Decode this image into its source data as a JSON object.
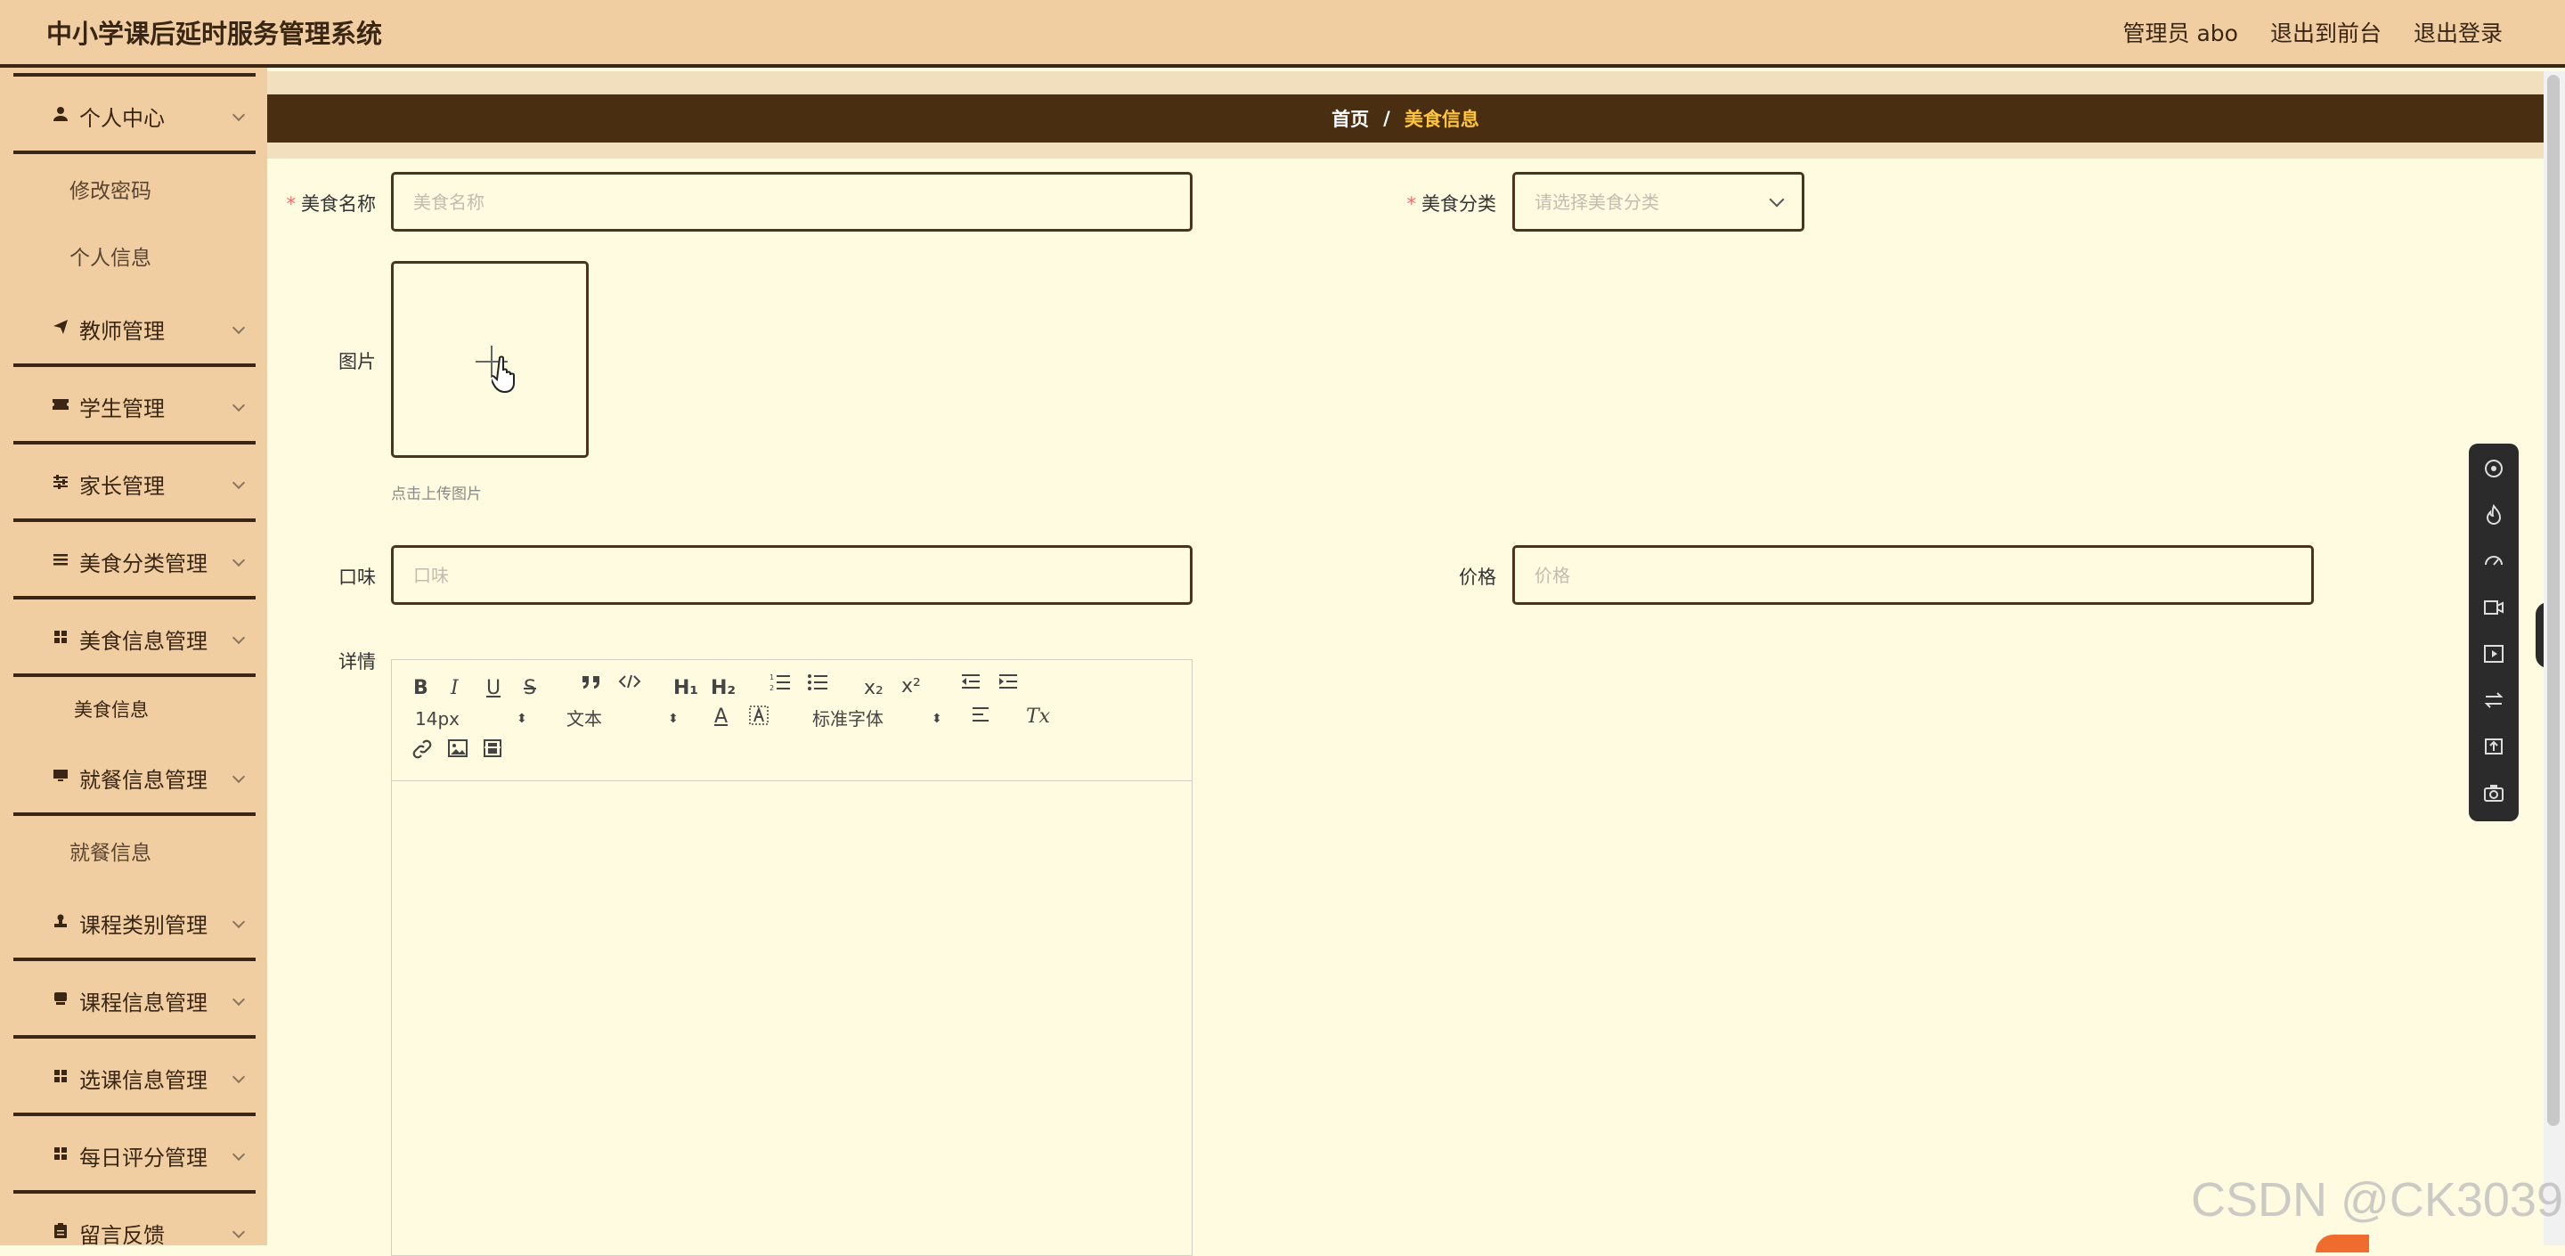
{
  "header": {
    "app_title": "中小学课后延时服务管理系统",
    "admin_label": "管理员 abo",
    "to_front_label": "退出到前台",
    "logout_label": "退出登录"
  },
  "sidebar": {
    "items": [
      {
        "label": "个人中心",
        "icon": "user-icon"
      },
      {
        "label": "修改密码"
      },
      {
        "label": "个人信息"
      },
      {
        "label": "教师管理",
        "icon": "send-icon"
      },
      {
        "label": "学生管理",
        "icon": "ticket-icon"
      },
      {
        "label": "家长管理",
        "icon": "sliders-icon"
      },
      {
        "label": "美食分类管理",
        "icon": "list-icon"
      },
      {
        "label": "美食信息管理",
        "icon": "grid-icon"
      },
      {
        "label": "美食信息"
      },
      {
        "label": "就餐信息管理",
        "icon": "monitor-icon"
      },
      {
        "label": "就餐信息"
      },
      {
        "label": "课程类别管理",
        "icon": "stamp-icon"
      },
      {
        "label": "课程信息管理",
        "icon": "box-icon"
      },
      {
        "label": "选课信息管理",
        "icon": "grid-icon"
      },
      {
        "label": "每日评分管理",
        "icon": "grid-icon"
      },
      {
        "label": "留言反馈",
        "icon": "clipboard-icon"
      }
    ]
  },
  "breadcrumb": {
    "home": "首页",
    "separator": "/",
    "current": "美食信息"
  },
  "form": {
    "name_label": "美食名称",
    "name_placeholder": "美食名称",
    "category_label": "美食分类",
    "category_placeholder": "请选择美食分类",
    "image_label": "图片",
    "upload_tip": "点击上传图片",
    "taste_label": "口味",
    "taste_placeholder": "口味",
    "price_label": "价格",
    "price_placeholder": "价格",
    "detail_label": "详情",
    "required_mark": "*"
  },
  "editor": {
    "size_value": "14px",
    "text_type_value": "文本",
    "font_value": "标准字体",
    "buttons": {
      "bold": "B",
      "italic": "I",
      "underline": "U",
      "strike": "S",
      "h1": "H₁",
      "h2": "H₂",
      "sub": "x₂",
      "sup": "x²",
      "color": "A",
      "clear": "Tx"
    }
  },
  "watermark": "CSDN @CK3039",
  "colors": {
    "accent": "#4a2e12",
    "sidebar_bg": "#f0cea1",
    "page_bg": "#fffbe0",
    "breadcrumb_current": "#ffc53d",
    "required": "#f56c6c"
  }
}
